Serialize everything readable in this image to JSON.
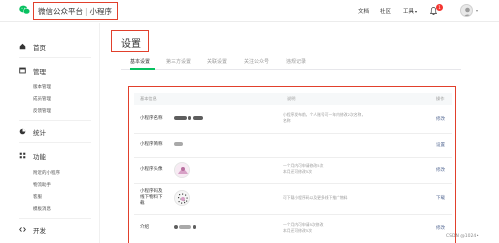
{
  "topbar": {
    "brand": "微信公众平台",
    "product": "小程序",
    "separator": "|",
    "nav": [
      "文档",
      "社区",
      "工具"
    ],
    "notification_count": "1",
    "icons": {
      "logo": "wechat-logo-icon",
      "bell": "bell-icon",
      "avatar": "avatar-icon"
    }
  },
  "sidebar": {
    "home": "首页",
    "manage": "管理",
    "manage_items": [
      "版本管理",
      "成员管理",
      "反馈管理"
    ],
    "stats": "统计",
    "features": "功能",
    "feature_items": [
      "附近的小程序",
      "物流助手",
      "客服",
      "模板消息"
    ],
    "dev": "开发"
  },
  "main": {
    "title": "设置",
    "tabs": [
      "基本设置",
      "第三方设置",
      "关联设置",
      "关注公众号",
      "违规记录"
    ],
    "active_tab": 0,
    "table": {
      "columns": [
        "基本信息",
        "说明",
        "操作"
      ],
      "rows": [
        {
          "label": "小程序名称",
          "desc": [
            "小程序发布前，个人账号可一年内修改2次名称，",
            "名称"
          ],
          "action": "修改"
        },
        {
          "label": "小程序简称",
          "desc": [],
          "action": "设置"
        },
        {
          "label": "小程序头像",
          "desc": [
            "一个月内可申请修改5次",
            "本月还可修改5次"
          ],
          "action": "修改"
        },
        {
          "label": "小程序码及线下物料下载",
          "label_lines": [
            "小程序码及",
            "线下物料下",
            "载"
          ],
          "desc": [
            "可下载小程序码以及更多线下推广物料"
          ],
          "action": "下载"
        },
        {
          "label": "介绍",
          "desc": [
            "一个月内可申请5次修改",
            "本月还可修改5次"
          ],
          "action": "修改"
        }
      ]
    }
  },
  "watermark": "CSDN @1024•"
}
